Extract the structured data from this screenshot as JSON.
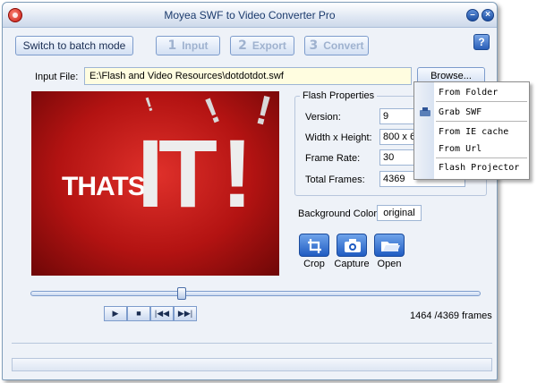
{
  "window": {
    "title": "Moyea SWF to Video Converter Pro"
  },
  "toolbar": {
    "batch_label": "Switch to batch mode",
    "steps": [
      {
        "num": "1",
        "label": "Input"
      },
      {
        "num": "2",
        "label": "Export"
      },
      {
        "num": "3",
        "label": "Convert"
      }
    ],
    "help_label": "?"
  },
  "input": {
    "label": "Input File:",
    "value": "E:\\Flash and Video Resources\\dotdotdot.swf",
    "browse_label": "Browse..."
  },
  "preview": {
    "text_small": "THATS",
    "text_big": "IT",
    "exclaim": "!"
  },
  "flash_properties": {
    "title": "Flash Properties",
    "rows": [
      {
        "label": "Version:",
        "value": "9"
      },
      {
        "label": "Width x Height:",
        "value": "800 x 600"
      },
      {
        "label": "Frame Rate:",
        "value": "30"
      },
      {
        "label": "Total Frames:",
        "value": "4369"
      }
    ]
  },
  "background": {
    "label": "Background Color:",
    "value": "original"
  },
  "actions": [
    {
      "label": "Crop",
      "icon": "crop-icon"
    },
    {
      "label": "Capture",
      "icon": "camera-icon"
    },
    {
      "label": "Open",
      "icon": "folder-icon"
    }
  ],
  "playback": {
    "controls": [
      "play",
      "stop",
      "previous",
      "next"
    ],
    "position_fraction": 0.335,
    "frames_text": "1464 /4369 frames"
  },
  "browse_menu": {
    "items": [
      "From Folder",
      "Grab SWF",
      "From IE cache",
      "From Url",
      "Flash Projector"
    ]
  },
  "colors": {
    "accent": "#1f5bc2",
    "input_bg": "#fffde0",
    "preview_red": "#c0161a"
  }
}
